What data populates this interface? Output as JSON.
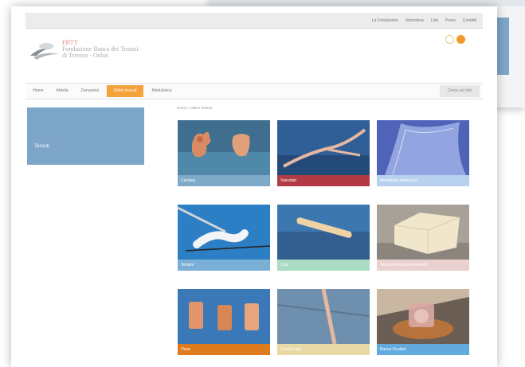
{
  "topbar": {
    "links": [
      "La Fondazione",
      "Normativa",
      "Link",
      "Press",
      "Contatti"
    ]
  },
  "brand": {
    "acronym": "FBTT",
    "line1": "Fondazione Banca dei Tessuti",
    "line2": "di Treviso - Onlus"
  },
  "nav": {
    "items": [
      "Home",
      "Attività",
      "Donazioni",
      "Ottimi tessuti",
      "Modulistica"
    ],
    "search_label": "Cerca nel sito"
  },
  "sidebar": {
    "label": "Tessuti"
  },
  "breadcrumb": "Home > Ottimi Tessuti",
  "tiles": [
    {
      "label": "Cardiaci",
      "color": "#7ea9c7"
    },
    {
      "label": "Vascolari",
      "color": "#b23a44"
    },
    {
      "label": "Membrana Amniotica",
      "color": "#b8d1ef"
    },
    {
      "label": "Tendini",
      "color": "#7bb0d6"
    },
    {
      "label": "Cute",
      "color": "#a9dcc3"
    },
    {
      "label": "Tessuti Muscolo-scheletrici",
      "color": "#ead1cf"
    },
    {
      "label": "Ossa",
      "color": "#e07a1f"
    },
    {
      "label": "Fascia Lata",
      "color": "#e8d9a7"
    },
    {
      "label": "Banca Oculare",
      "color": "#63abdc"
    }
  ]
}
